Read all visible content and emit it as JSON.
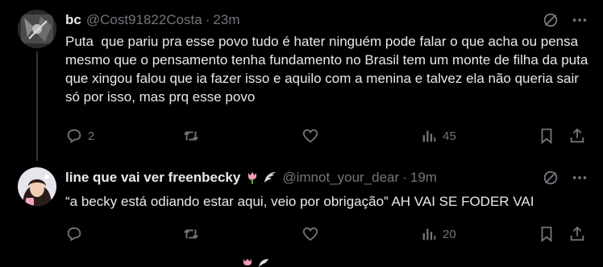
{
  "tweets": [
    {
      "name": "bc",
      "handle": "@Cost91822Costa",
      "time": "23m",
      "text": "Puta  que pariu pra esse povo tudo é hater ninguém pode falar o que acha ou pensa mesmo que o pensamento tenha fundamento no Brasil tem um monte de filha da puta  que xingou falou que ia fazer isso e aquilo com a menina e talvez ela não queria sair só por isso, mas prq esse povo",
      "reply_count": "2",
      "retweet_count": "",
      "like_count": "",
      "view_count": "45"
    },
    {
      "name": "line que vai ver freenbecky",
      "name_emojis": [
        "tulip-icon",
        "wing-icon"
      ],
      "handle": "@imnot_your_dear",
      "time": "19m",
      "text": "“a becky está odiando estar aqui, veio por obrigação” AH VAI SE FODER VAI",
      "reply_count": "",
      "retweet_count": "",
      "like_count": "",
      "view_count": "20"
    }
  ],
  "separator": "·",
  "colors": {
    "background": "#000000",
    "primary_text": "#e7e9ea",
    "secondary_text": "#71767b",
    "thread_line": "#333639"
  }
}
